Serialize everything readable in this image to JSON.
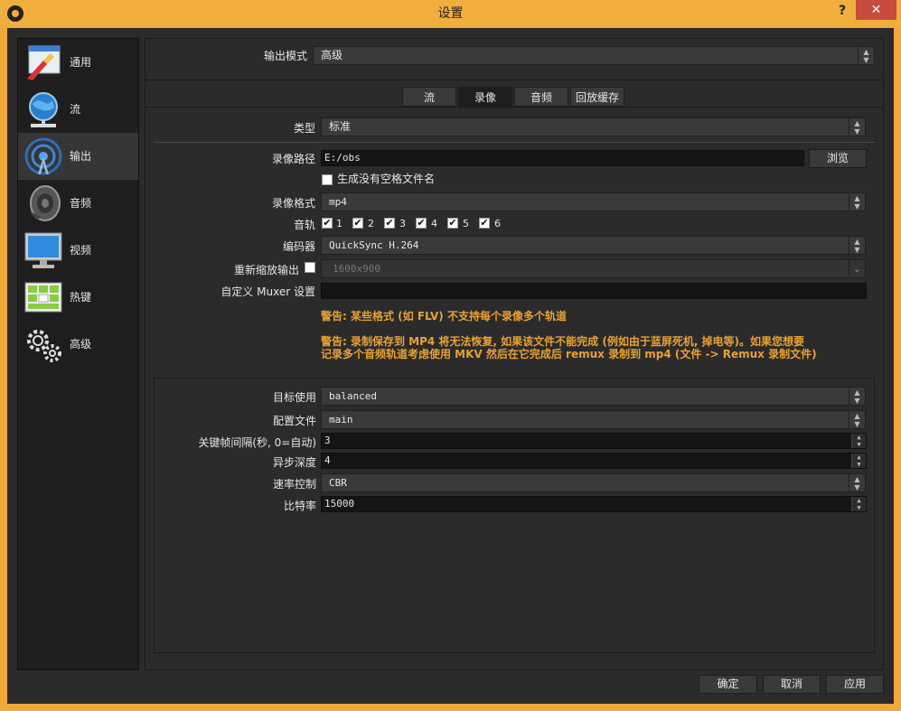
{
  "window": {
    "title": "设置",
    "help": "?",
    "close": "✕"
  },
  "sidebar": {
    "items": [
      {
        "label": "通用",
        "icon": "general-icon"
      },
      {
        "label": "流",
        "icon": "stream-globe-icon"
      },
      {
        "label": "输出",
        "icon": "output-antenna-icon"
      },
      {
        "label": "音频",
        "icon": "speaker-icon"
      },
      {
        "label": "视频",
        "icon": "monitor-icon"
      },
      {
        "label": "热键",
        "icon": "keyboard-icon"
      },
      {
        "label": "高级",
        "icon": "gears-icon"
      }
    ],
    "active_index": 2
  },
  "output_mode": {
    "label": "输出模式",
    "value": "高级"
  },
  "tabs": [
    {
      "label": "流"
    },
    {
      "label": "录像"
    },
    {
      "label": "音频"
    },
    {
      "label": "回放缓存"
    }
  ],
  "active_tab": "录像",
  "recording": {
    "type": {
      "label": "类型",
      "value": "标准"
    },
    "path": {
      "label": "录像路径",
      "value": "E:/obs",
      "browse": "浏览"
    },
    "no_space": {
      "label": "生成没有空格文件名",
      "checked": false
    },
    "format": {
      "label": "录像格式",
      "value": "mp4"
    },
    "tracks": {
      "label": "音轨",
      "items": [
        "1",
        "2",
        "3",
        "4",
        "5",
        "6"
      ]
    },
    "encoder": {
      "label": "编码器",
      "value": "QuickSync H.264"
    },
    "rescale": {
      "label": "重新缩放输出",
      "value": "1600x900",
      "checked": false
    },
    "muxer": {
      "label": "自定义 Muxer 设置",
      "value": ""
    },
    "warning1": "警告: 某些格式 (如 FLV) 不支持每个录像多个轨道",
    "warning2_line1": "警告:  录制保存到 MP4 将无法恢复, 如果该文件不能完成 (例如由于蓝屏死机, 掉电等)。如果您想要",
    "warning2_line2": "记录多个音频轨道考虑使用 MKV 然后在它完成后 remux 录制到 mp4 (文件 -> Remux 录制文件)"
  },
  "encoder_settings": {
    "target_usage": {
      "label": "目标使用",
      "value": "balanced"
    },
    "profile": {
      "label": "配置文件",
      "value": "main"
    },
    "keyframe": {
      "label": "关键帧间隔(秒, 0=自动)",
      "value": "3"
    },
    "async_depth": {
      "label": "异步深度",
      "value": "4"
    },
    "rate_control": {
      "label": "速率控制",
      "value": "CBR"
    },
    "bitrate": {
      "label": "比特率",
      "value": "15000"
    }
  },
  "footer": {
    "ok": "确定",
    "cancel": "取消",
    "apply": "应用"
  },
  "colors": {
    "title_bar": "#f2ae3d",
    "warning": "#e8a233",
    "close": "#c74b3f"
  }
}
